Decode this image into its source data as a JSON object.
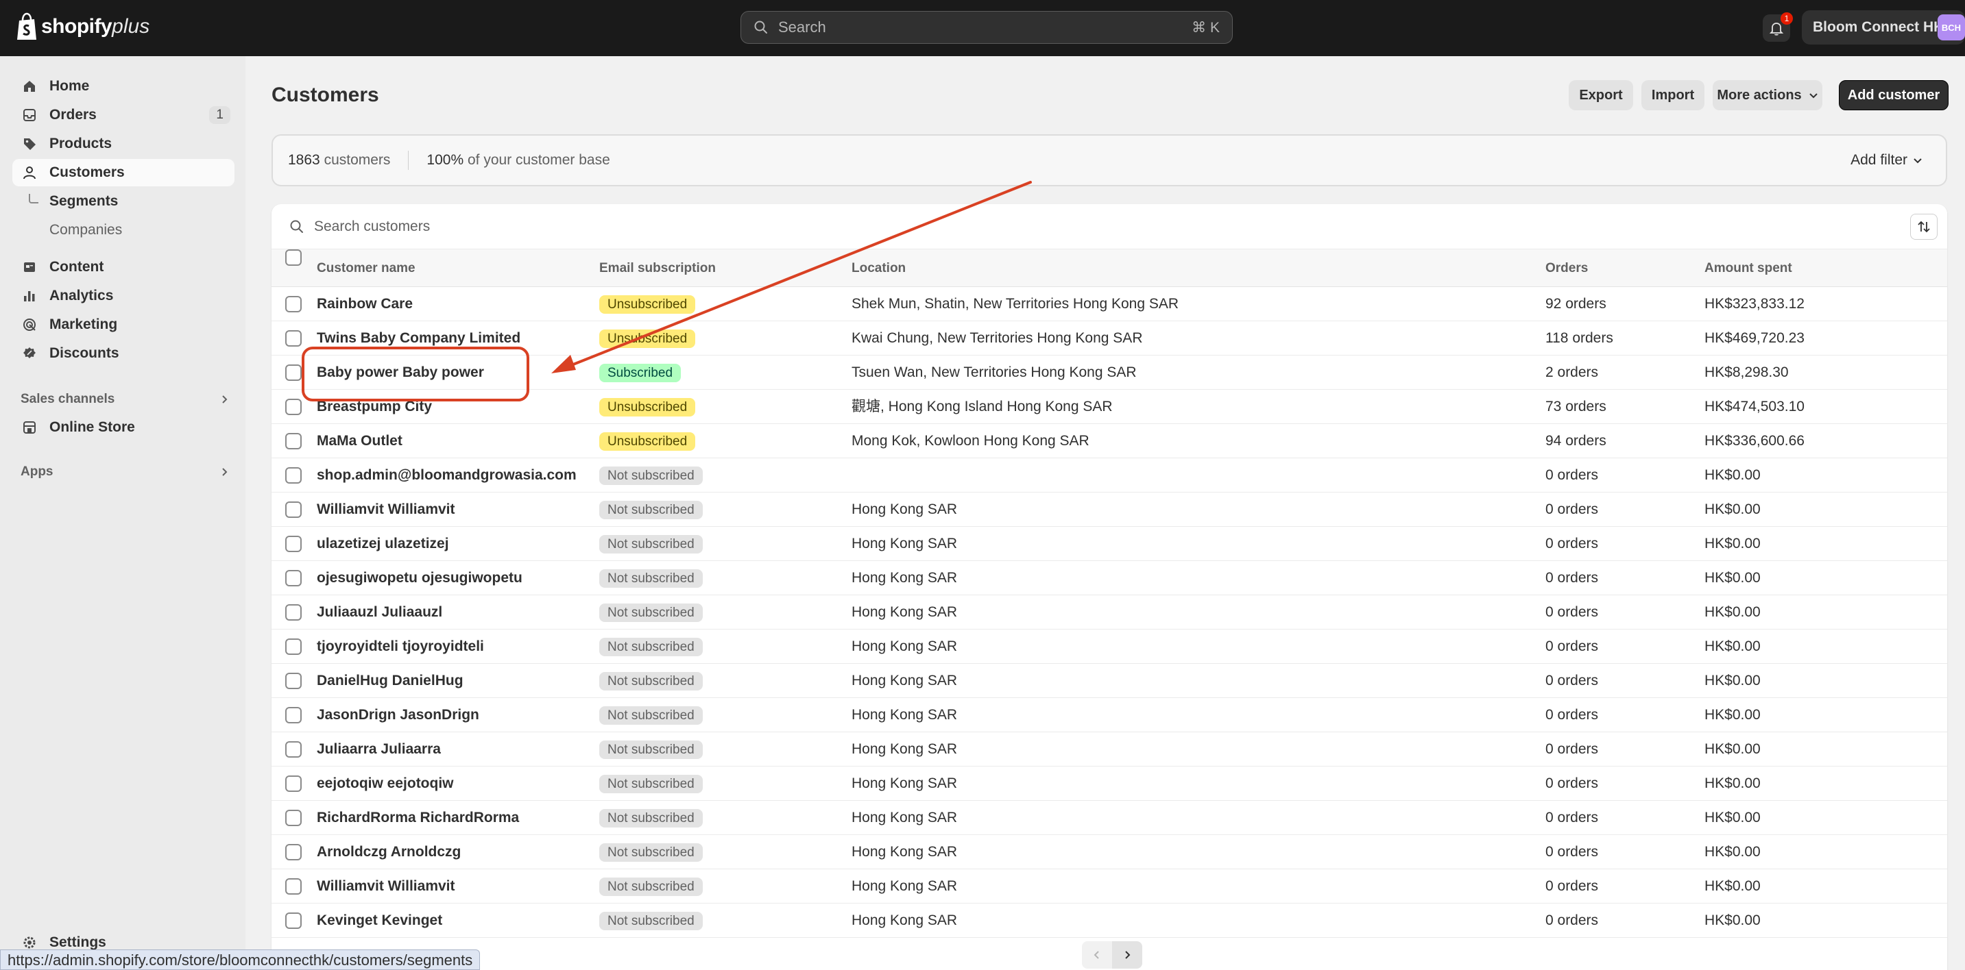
{
  "topbar": {
    "logo_text": "shopify",
    "logo_plus": "plus",
    "search_placeholder": "Search",
    "search_shortcut": "⌘ K",
    "notification_count": "1",
    "store_name": "Bloom Connect HK",
    "store_initials": "BCH"
  },
  "sidebar": {
    "items": [
      {
        "label": "Home",
        "icon": "home-icon"
      },
      {
        "label": "Orders",
        "icon": "orders-icon",
        "count": "1"
      },
      {
        "label": "Products",
        "icon": "tag-icon"
      },
      {
        "label": "Customers",
        "icon": "person-icon"
      },
      {
        "label": "Content",
        "icon": "content-icon"
      },
      {
        "label": "Analytics",
        "icon": "analytics-icon"
      },
      {
        "label": "Marketing",
        "icon": "target-icon"
      },
      {
        "label": "Discounts",
        "icon": "discount-icon"
      }
    ],
    "sub_segments": "Segments",
    "sub_companies": "Companies",
    "sales_channels": "Sales channels",
    "online_store": "Online Store",
    "apps": "Apps",
    "settings": "Settings"
  },
  "header": {
    "title": "Customers",
    "export": "Export",
    "import": "Import",
    "more_actions": "More actions",
    "add_customer": "Add customer"
  },
  "summary": {
    "count": "1863",
    "count_suffix": "customers",
    "percent": "100%",
    "percent_suffix": "of your customer base",
    "add_filter": "Add filter"
  },
  "table": {
    "search_placeholder": "Search customers",
    "columns": [
      "Customer name",
      "Email subscription",
      "Location",
      "Orders",
      "Amount spent"
    ],
    "rows": [
      {
        "name": "Rainbow Care",
        "email": "Unsubscribed",
        "status": "unsub",
        "location": "Shek Mun, Shatin, New Territories Hong Kong SAR",
        "orders": "92 orders",
        "amount": "HK$323,833.12"
      },
      {
        "name": "Twins Baby Company Limited",
        "email": "Unsubscribed",
        "status": "unsub",
        "location": "Kwai Chung, New Territories Hong Kong SAR",
        "orders": "118 orders",
        "amount": "HK$469,720.23"
      },
      {
        "name": "Baby power Baby power",
        "email": "Subscribed",
        "status": "sub",
        "location": "Tsuen Wan, New Territories Hong Kong SAR",
        "orders": "2 orders",
        "amount": "HK$8,298.30"
      },
      {
        "name": "Breastpump City",
        "email": "Unsubscribed",
        "status": "unsub",
        "location": "觀塘, Hong Kong Island Hong Kong SAR",
        "orders": "73 orders",
        "amount": "HK$474,503.10"
      },
      {
        "name": "MaMa Outlet",
        "email": "Unsubscribed",
        "status": "unsub",
        "location": "Mong Kok, Kowloon Hong Kong SAR",
        "orders": "94 orders",
        "amount": "HK$336,600.66"
      },
      {
        "name": "shop.admin@bloomandgrowasia.com",
        "email": "Not subscribed",
        "status": "none",
        "location": "",
        "orders": "0 orders",
        "amount": "HK$0.00"
      },
      {
        "name": "Williamvit Williamvit",
        "email": "Not subscribed",
        "status": "none",
        "location": "Hong Kong SAR",
        "orders": "0 orders",
        "amount": "HK$0.00"
      },
      {
        "name": "ulazetizej ulazetizej",
        "email": "Not subscribed",
        "status": "none",
        "location": "Hong Kong SAR",
        "orders": "0 orders",
        "amount": "HK$0.00"
      },
      {
        "name": "ojesugiwopetu ojesugiwopetu",
        "email": "Not subscribed",
        "status": "none",
        "location": "Hong Kong SAR",
        "orders": "0 orders",
        "amount": "HK$0.00"
      },
      {
        "name": "Juliaauzl Juliaauzl",
        "email": "Not subscribed",
        "status": "none",
        "location": "Hong Kong SAR",
        "orders": "0 orders",
        "amount": "HK$0.00"
      },
      {
        "name": "tjoyroyidteli tjoyroyidteli",
        "email": "Not subscribed",
        "status": "none",
        "location": "Hong Kong SAR",
        "orders": "0 orders",
        "amount": "HK$0.00"
      },
      {
        "name": "DanielHug DanielHug",
        "email": "Not subscribed",
        "status": "none",
        "location": "Hong Kong SAR",
        "orders": "0 orders",
        "amount": "HK$0.00"
      },
      {
        "name": "JasonDrign JasonDrign",
        "email": "Not subscribed",
        "status": "none",
        "location": "Hong Kong SAR",
        "orders": "0 orders",
        "amount": "HK$0.00"
      },
      {
        "name": "Juliaarra Juliaarra",
        "email": "Not subscribed",
        "status": "none",
        "location": "Hong Kong SAR",
        "orders": "0 orders",
        "amount": "HK$0.00"
      },
      {
        "name": "eejotoqiw eejotoqiw",
        "email": "Not subscribed",
        "status": "none",
        "location": "Hong Kong SAR",
        "orders": "0 orders",
        "amount": "HK$0.00"
      },
      {
        "name": "RichardRorma RichardRorma",
        "email": "Not subscribed",
        "status": "none",
        "location": "Hong Kong SAR",
        "orders": "0 orders",
        "amount": "HK$0.00"
      },
      {
        "name": "Arnoldczg Arnoldczg",
        "email": "Not subscribed",
        "status": "none",
        "location": "Hong Kong SAR",
        "orders": "0 orders",
        "amount": "HK$0.00"
      },
      {
        "name": "Williamvit Williamvit",
        "email": "Not subscribed",
        "status": "none",
        "location": "Hong Kong SAR",
        "orders": "0 orders",
        "amount": "HK$0.00"
      },
      {
        "name": "Kevinget Kevinget",
        "email": "Not subscribed",
        "status": "none",
        "location": "Hong Kong SAR",
        "orders": "0 orders",
        "amount": "HK$0.00"
      }
    ]
  },
  "status_bar_url": "https://admin.shopify.com/store/bloomconnecthk/customers/segments",
  "colors": {
    "topbar": "#1a1a1a",
    "annotation": "#d94123",
    "unsubscribed_badge": "#ffeb78",
    "subscribed_badge": "#affebf"
  }
}
